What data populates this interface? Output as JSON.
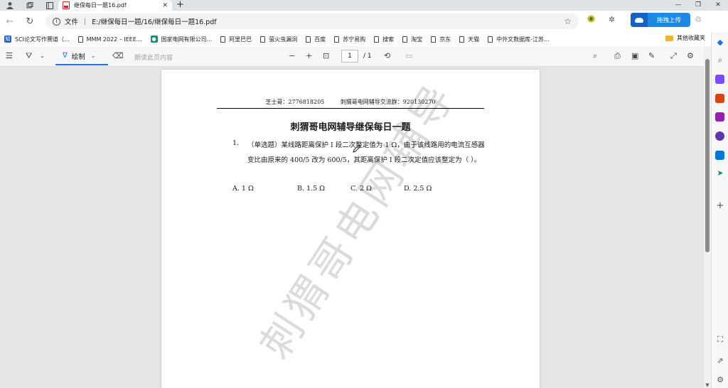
{
  "browser": {
    "tab_title": "继保每日一题16.pdf",
    "address_prefix": "文件",
    "address_path": "E:/继保每日一题/16/继保每日一题16.pdf",
    "upload_label": "拖拽上传"
  },
  "bookmarks": [
    {
      "label": "SCI论文写作赛道（...",
      "kind": "fav",
      "color": "#1e63c4",
      "glyph": "知"
    },
    {
      "label": "MMM 2022 – IEEE...",
      "kind": "doc"
    },
    {
      "label": "国家电网有限公司...",
      "kind": "fav",
      "color": "#1b8a6b",
      "glyph": "●"
    },
    {
      "label": "阿里巴巴",
      "kind": "doc"
    },
    {
      "label": "萤火虫漏洞",
      "kind": "doc"
    },
    {
      "label": "百度",
      "kind": "doc"
    },
    {
      "label": "苏宁易购",
      "kind": "doc"
    },
    {
      "label": "搜索",
      "kind": "doc"
    },
    {
      "label": "淘宝",
      "kind": "doc"
    },
    {
      "label": "京东",
      "kind": "doc"
    },
    {
      "label": "天猫",
      "kind": "doc"
    },
    {
      "label": "中外文数据库-江苏...",
      "kind": "doc"
    }
  ],
  "bookmarks_folder": "其他收藏夹",
  "pdf_toolbar": {
    "draw_label": "绘制",
    "read_aloud_label": "朗读此页内容",
    "page_current": "1",
    "page_total": "/ 1"
  },
  "document": {
    "header_left": "芝士哥：2776818205",
    "header_right": "刺猬哥电网辅导交流群：920130270",
    "title": "刺猬哥电网辅导继保每日一题",
    "question_number": "1.",
    "question_text": "（单选题）某线路距离保护 I 段二次整定值为 1 Ω，由于该线路用的电流互感器变比由原来的 400/5 改为 600/5，其距离保护 I 段二次定值应该整定为（  ）。",
    "options": [
      "A. 1 Ω",
      "B. 1.5 Ω",
      "C. 2 Ω",
      "D. 2.5 Ω"
    ],
    "watermark": "刺猬哥电网辅导"
  },
  "colors": {
    "accent": "#1a73e8",
    "upload_button": "#1e88e5",
    "folder": "#f2b233"
  }
}
